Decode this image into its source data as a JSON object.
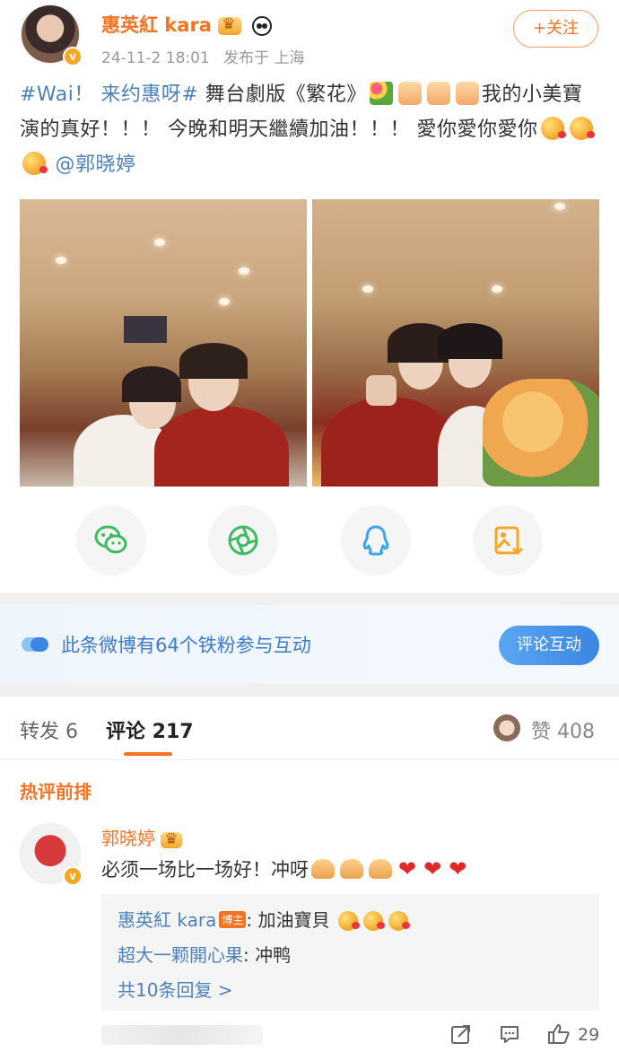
{
  "post": {
    "author": "惠英紅 kara",
    "time": "24-11-2 18:01",
    "location": "发布于 上海",
    "follow_label": "+关注",
    "hashtag": "#Wai！ 来约惠呀#",
    "text_1": " 舞台劇版《繁花》",
    "text_2": "我的小美寶演的真好！！！ 今晚和明天繼續加油！！！ 愛你愛你愛你",
    "mention": "@郭晓婷"
  },
  "share": {
    "icons": [
      "wechat-icon",
      "moments-icon",
      "qq-icon",
      "save-image-icon"
    ]
  },
  "fans_bar": {
    "text": "此条微博有64个铁粉参与互动",
    "button": "评论互动"
  },
  "tabs": {
    "repost": "转发 6",
    "comments": "评论 217",
    "likes": "赞 408"
  },
  "comments": {
    "section_title": "热评前排",
    "items": [
      {
        "author": "郭晓婷",
        "text": "必须一场比一场好！冲呀",
        "replies": [
          {
            "author": "惠英紅 kara",
            "badge": "博主",
            "text": ": 加油寶貝"
          },
          {
            "author": "超大一颗開心果",
            "text": ": 冲鸭"
          }
        ],
        "more_replies": "共10条回复 >",
        "like_count": "29"
      }
    ]
  },
  "colors": {
    "brand_orange": "#f47321",
    "link_blue": "#4e81b9",
    "button_blue": "#3b86e2"
  }
}
